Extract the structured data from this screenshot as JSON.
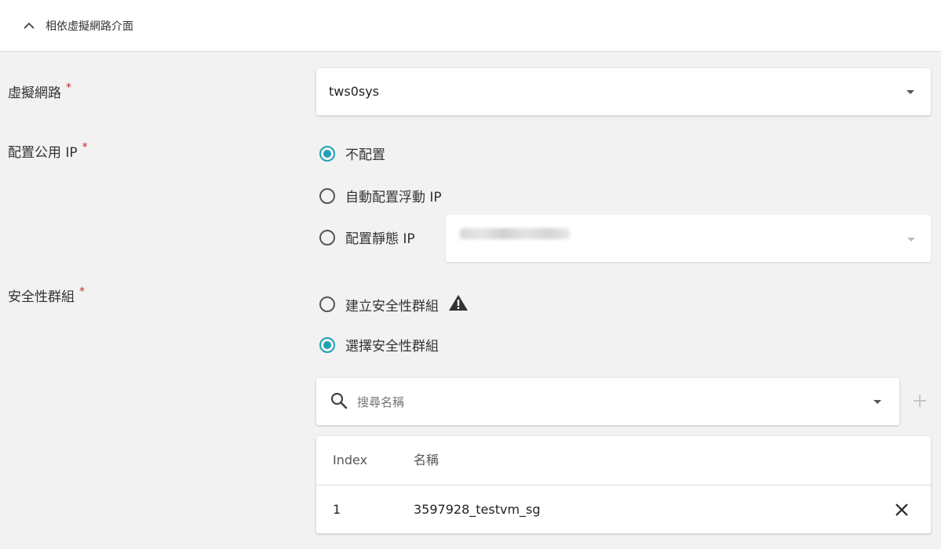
{
  "section": {
    "title": "相依虛擬網路介面"
  },
  "fields": {
    "network": {
      "label": "虛擬網路",
      "required_mark": "*",
      "value": "tws0sys"
    },
    "public_ip": {
      "label": "配置公用 IP",
      "required_mark": "*",
      "options": [
        {
          "label": "不配置",
          "checked": true
        },
        {
          "label": "自動配置浮動 IP",
          "checked": false
        },
        {
          "label": "配置靜態 IP",
          "checked": false
        }
      ],
      "static_ip_value_obscured": true
    },
    "security_group": {
      "label": "安全性群組",
      "required_mark": "*",
      "options": [
        {
          "label": "建立安全性群組",
          "checked": false,
          "icon": "warning-icon"
        },
        {
          "label": "選擇安全性群組",
          "checked": true
        }
      ],
      "search": {
        "placeholder": "搜尋名稱"
      },
      "table": {
        "columns": [
          "Index",
          "名稱"
        ],
        "rows": [
          {
            "index": "1",
            "name": "3597928_testvm_sg"
          }
        ]
      }
    }
  },
  "colors": {
    "accent": "#1fa2b5",
    "required": "#c62828"
  }
}
